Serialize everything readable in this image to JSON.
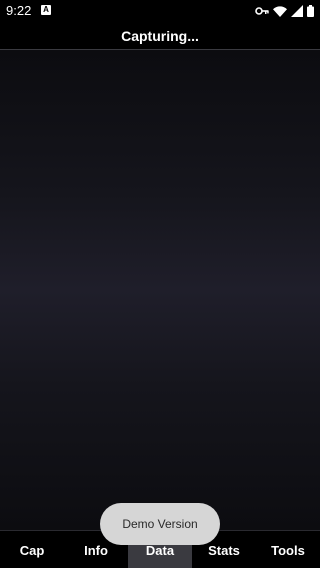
{
  "status_bar": {
    "time": "9:22",
    "notification_icon": "a-icon",
    "notification_letter": "A",
    "icons": [
      "key-icon",
      "wifi-icon",
      "signal-icon",
      "battery-icon"
    ]
  },
  "header": {
    "title": "Capturing..."
  },
  "toast": {
    "message": "Demo Version"
  },
  "bottom_nav": {
    "items": [
      {
        "label": "Cap"
      },
      {
        "label": "Info"
      },
      {
        "label": "Data",
        "active": true
      },
      {
        "label": "Stats"
      },
      {
        "label": "Tools"
      }
    ]
  },
  "colors": {
    "background": "#000000",
    "capture_gradient_center": "#1f1e2a",
    "toast_background": "#d6d6d6",
    "active_tab": "#3a3a40"
  }
}
